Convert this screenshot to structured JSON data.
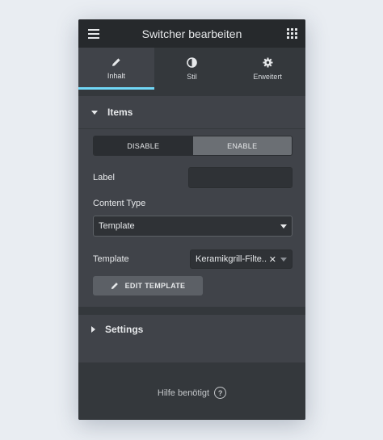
{
  "header": {
    "title": "Switcher bearbeiten"
  },
  "tabs": [
    {
      "label": "Inhalt",
      "icon": "pencil-icon",
      "active": true
    },
    {
      "label": "Stil",
      "icon": "half-circle-icon",
      "active": false
    },
    {
      "label": "Erweitert",
      "icon": "gear-icon",
      "active": false
    }
  ],
  "items_section": {
    "title": "Items",
    "toggle": {
      "disable_label": "DISABLE",
      "enable_label": "ENABLE",
      "selected": "ENABLE"
    },
    "label_field": {
      "label": "Label",
      "value": ""
    },
    "content_type": {
      "label": "Content Type",
      "value": "Template"
    },
    "template": {
      "label": "Template",
      "value": "Keramikgrill-Filte..."
    },
    "edit_button": {
      "label": "EDIT TEMPLATE"
    }
  },
  "settings_section": {
    "title": "Settings"
  },
  "help": {
    "label": "Hilfe benötigt",
    "icon_glyph": "?"
  },
  "colors": {
    "accent": "#71d7f7",
    "panel_bg": "#404349",
    "header_bg": "#26292c",
    "page_bg": "#e9edf2"
  }
}
